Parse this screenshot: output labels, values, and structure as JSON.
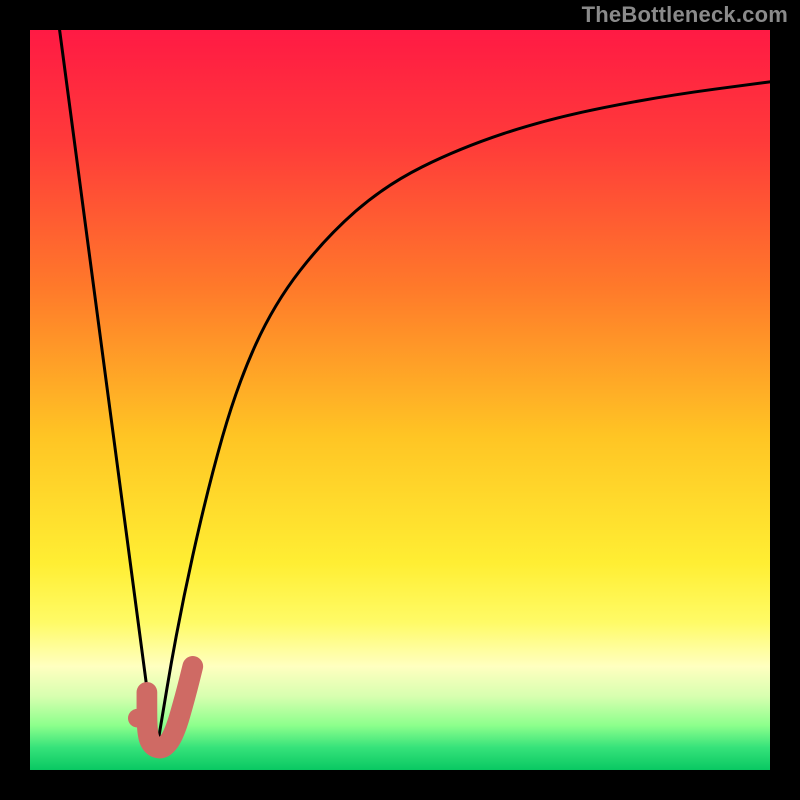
{
  "watermark": "TheBottleneck.com",
  "colors": {
    "frame": "#000000",
    "watermark": "#8a8a8a",
    "curve": "#000000",
    "marker_fill": "#cf6a64",
    "marker_stroke": "#cf6a64",
    "gradient_stops": [
      {
        "offset": 0.0,
        "color": "#ff1a44"
      },
      {
        "offset": 0.15,
        "color": "#ff3a3a"
      },
      {
        "offset": 0.35,
        "color": "#ff7a2a"
      },
      {
        "offset": 0.55,
        "color": "#ffc524"
      },
      {
        "offset": 0.72,
        "color": "#ffee33"
      },
      {
        "offset": 0.8,
        "color": "#fffb66"
      },
      {
        "offset": 0.86,
        "color": "#ffffc0"
      },
      {
        "offset": 0.9,
        "color": "#d8ffb0"
      },
      {
        "offset": 0.94,
        "color": "#8cff8c"
      },
      {
        "offset": 0.97,
        "color": "#35e27a"
      },
      {
        "offset": 1.0,
        "color": "#09c862"
      }
    ]
  },
  "chart_data": {
    "type": "line",
    "title": "",
    "xlabel": "",
    "ylabel": "",
    "xlim": [
      0,
      100
    ],
    "ylim": [
      0,
      100
    ],
    "series": [
      {
        "name": "left-branch",
        "x": [
          4,
          17
        ],
        "y": [
          100,
          2
        ]
      },
      {
        "name": "right-branch",
        "x": [
          17,
          20,
          24,
          28,
          33,
          40,
          48,
          58,
          70,
          85,
          100
        ],
        "y": [
          2,
          20,
          38,
          52,
          63,
          72,
          79,
          84,
          88,
          91,
          93
        ]
      }
    ],
    "marker": {
      "name": "j-shape-marker",
      "dot": {
        "x": 14.5,
        "y": 7
      },
      "hook": [
        {
          "x": 15.8,
          "y": 10.5
        },
        {
          "x": 15.8,
          "y": 5.0
        },
        {
          "x": 16.5,
          "y": 3.2
        },
        {
          "x": 18.0,
          "y": 2.8
        },
        {
          "x": 19.5,
          "y": 4.8
        },
        {
          "x": 21.0,
          "y": 10.0
        },
        {
          "x": 22.0,
          "y": 14.0
        }
      ],
      "stroke_width_pct": 2.8
    }
  }
}
